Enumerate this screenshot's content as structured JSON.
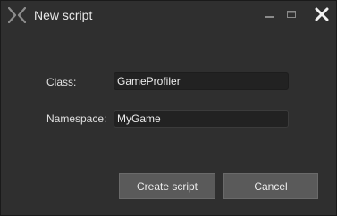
{
  "window": {
    "title": "New script"
  },
  "form": {
    "class_label": "Class:",
    "class_value": "GameProfiler",
    "namespace_label": "Namespace:",
    "namespace_value": "MyGame"
  },
  "buttons": {
    "create_label": "Create script",
    "cancel_label": "Cancel"
  },
  "icons": {
    "logo": "app-logo-icon",
    "minimize": "minimize-icon",
    "maximize": "maximize-icon",
    "close": "close-icon"
  },
  "colors": {
    "background": "#2f2f2f",
    "field_background": "#222222",
    "button_background": "#5a5a5a"
  }
}
